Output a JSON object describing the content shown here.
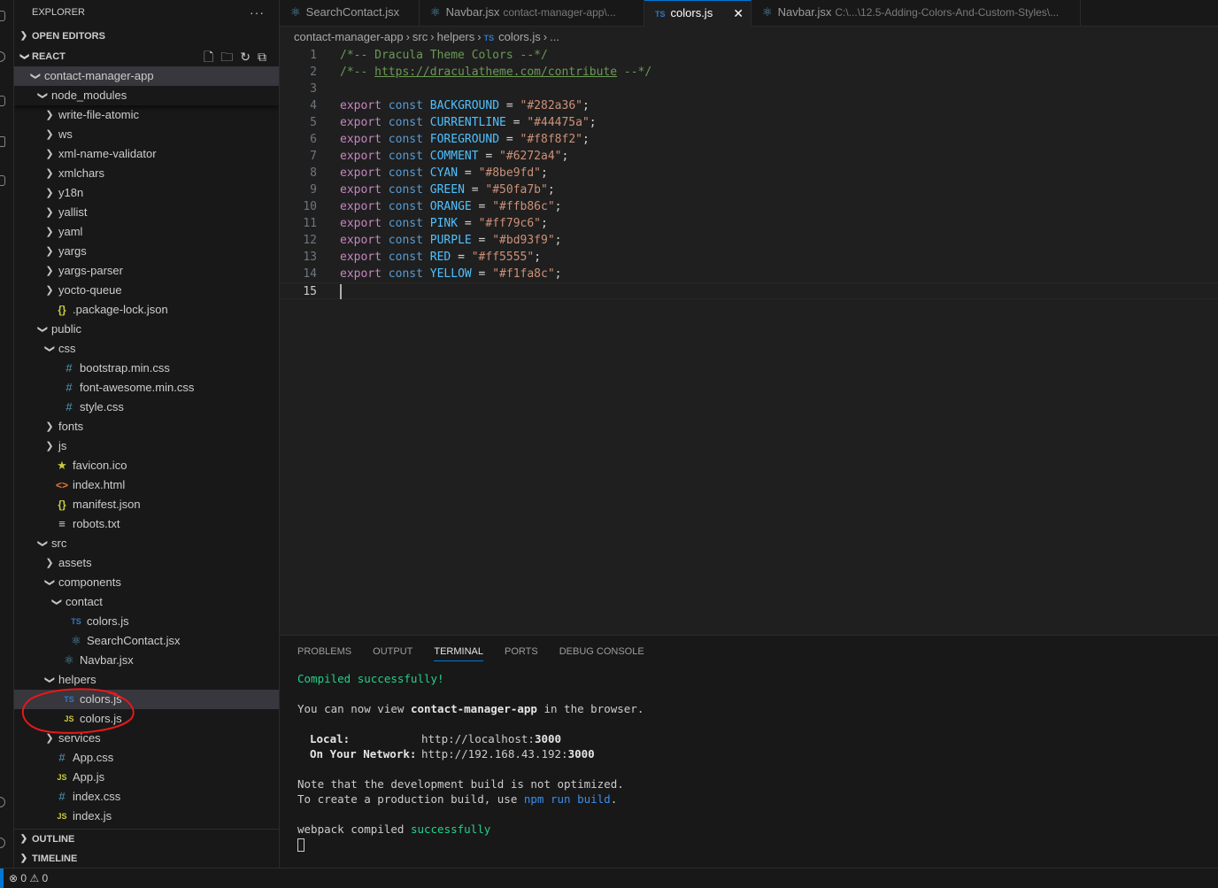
{
  "explorer": {
    "title": "EXPLORER",
    "more": "···",
    "open_editors": "OPEN EDITORS",
    "root": "REACT",
    "outline": "OUTLINE",
    "timeline": "TIMELINE",
    "tree": [
      {
        "label": "contact-manager-app",
        "type": "folder-open"
      },
      {
        "label": "node_modules",
        "type": "folder-open"
      },
      {
        "label": "write-file-atomic",
        "type": "folder"
      },
      {
        "label": "ws",
        "type": "folder"
      },
      {
        "label": "xml-name-validator",
        "type": "folder"
      },
      {
        "label": "xmlchars",
        "type": "folder"
      },
      {
        "label": "y18n",
        "type": "folder"
      },
      {
        "label": "yallist",
        "type": "folder"
      },
      {
        "label": "yaml",
        "type": "folder"
      },
      {
        "label": "yargs",
        "type": "folder"
      },
      {
        "label": "yargs-parser",
        "type": "folder"
      },
      {
        "label": "yocto-queue",
        "type": "folder"
      },
      {
        "label": ".package-lock.json",
        "type": "json"
      },
      {
        "label": "public",
        "type": "folder-open"
      },
      {
        "label": "css",
        "type": "folder-open"
      },
      {
        "label": "bootstrap.min.css",
        "type": "css"
      },
      {
        "label": "font-awesome.min.css",
        "type": "css"
      },
      {
        "label": "style.css",
        "type": "css"
      },
      {
        "label": "fonts",
        "type": "folder"
      },
      {
        "label": "js",
        "type": "folder"
      },
      {
        "label": "favicon.ico",
        "type": "ico"
      },
      {
        "label": "index.html",
        "type": "html"
      },
      {
        "label": "manifest.json",
        "type": "json"
      },
      {
        "label": "robots.txt",
        "type": "txt"
      },
      {
        "label": "src",
        "type": "folder-open"
      },
      {
        "label": "assets",
        "type": "folder"
      },
      {
        "label": "components",
        "type": "folder-open"
      },
      {
        "label": "contact",
        "type": "folder-open"
      },
      {
        "label": "colors.js",
        "type": "ts"
      },
      {
        "label": "SearchContact.jsx",
        "type": "react"
      },
      {
        "label": "Navbar.jsx",
        "type": "react"
      },
      {
        "label": "helpers",
        "type": "folder-open"
      },
      {
        "label": "colors.js",
        "type": "ts"
      },
      {
        "label": "colors.js",
        "type": "js"
      },
      {
        "label": "services",
        "type": "folder"
      },
      {
        "label": "App.css",
        "type": "css"
      },
      {
        "label": "App.js",
        "type": "js"
      },
      {
        "label": "index.css",
        "type": "css"
      },
      {
        "label": "index.js",
        "type": "js"
      }
    ]
  },
  "icons": {
    "ts": "TS",
    "js": "JS",
    "css": "#",
    "json": "{}",
    "html": "<>",
    "react": "⚛",
    "ico": "★",
    "txt": "≡"
  },
  "tabs": [
    {
      "label": "SearchContact.jsx",
      "desc": "",
      "icon": "⚛"
    },
    {
      "label": "Navbar.jsx",
      "desc": "contact-manager-app\\...",
      "icon": "⚛"
    },
    {
      "label": "colors.js",
      "desc": "",
      "icon": "TS",
      "close": "✕"
    },
    {
      "label": "Navbar.jsx",
      "desc": "C:\\...\\12.5-Adding-Colors-And-Custom-Styles\\...",
      "icon": "⚛"
    }
  ],
  "breadcrumb": {
    "parts": [
      "contact-manager-app",
      "src",
      "helpers"
    ],
    "file_icon": "TS",
    "file": "colors.js",
    "tail": "..."
  },
  "editor": {
    "comment1": "/*-- Dracula Theme Colors --*/",
    "comment2_pre": "/*-- ",
    "comment2_link": "https://draculatheme.com/contribute",
    "comment2_post": " --*/",
    "kw_export": "export",
    "kw_const": "const",
    "constants": [
      {
        "name": "BACKGROUND",
        "value": "\"#282a36\""
      },
      {
        "name": "CURRENTLINE",
        "value": "\"#44475a\""
      },
      {
        "name": "FOREGROUND",
        "value": "\"#f8f8f2\""
      },
      {
        "name": "COMMENT",
        "value": "\"#6272a4\""
      },
      {
        "name": "CYAN",
        "value": "\"#8be9fd\""
      },
      {
        "name": "GREEN",
        "value": "\"#50fa7b\""
      },
      {
        "name": "ORANGE",
        "value": "\"#ffb86c\""
      },
      {
        "name": "PINK",
        "value": "\"#ff79c6\""
      },
      {
        "name": "PURPLE",
        "value": "\"#bd93f9\""
      },
      {
        "name": "RED",
        "value": "\"#ff5555\""
      },
      {
        "name": "YELLOW",
        "value": "\"#f1fa8c\""
      }
    ],
    "line_numbers": [
      "1",
      "2",
      "3",
      "4",
      "5",
      "6",
      "7",
      "8",
      "9",
      "10",
      "11",
      "12",
      "13",
      "14",
      "15"
    ]
  },
  "panel": {
    "tabs": [
      "PROBLEMS",
      "OUTPUT",
      "TERMINAL",
      "PORTS",
      "DEBUG CONSOLE"
    ],
    "active": "TERMINAL",
    "terminal": {
      "compiled": "Compiled successfully!",
      "view_pre": "You can now view ",
      "view_app": "contact-manager-app",
      "view_post": " in the browser.",
      "local_label": "Local:",
      "local_url_pre": "http://localhost:",
      "local_port": "3000",
      "network_label": "On Your Network:",
      "network_url_pre": "http://192.168.43.192:",
      "network_port": "3000",
      "note1": "Note that the development build is not optimized.",
      "note2_pre": "To create a production build, use ",
      "note2_cmd": "npm run build",
      "note2_post": ".",
      "webpack_pre": "webpack compiled ",
      "webpack_ok": "successfully"
    }
  },
  "status": {
    "errors_icon": "⊗",
    "errors": "0",
    "warnings_icon": "⚠",
    "warnings": "0"
  },
  "colors": {
    "accent": "#0078d4",
    "editor_bg": "#1f1f1f",
    "sidebar_bg": "#181818",
    "annotation": "#e81818"
  }
}
